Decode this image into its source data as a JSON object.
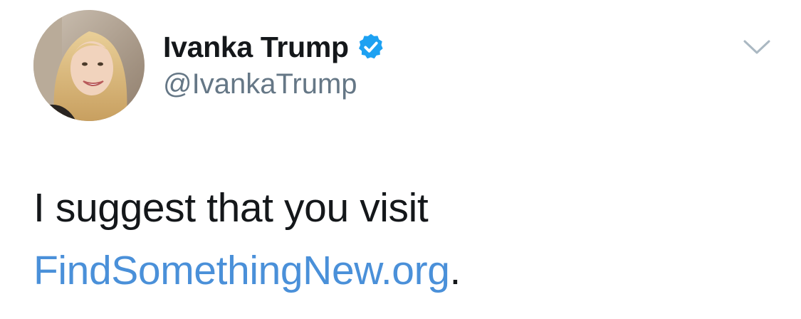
{
  "author": {
    "display_name": "Ivanka Trump",
    "handle": "@IvankaTrump",
    "verified": true,
    "avatar_icon": "profile-photo"
  },
  "menu": {
    "icon": "chevron-down-icon"
  },
  "tweet": {
    "text_line1": "I suggest that you visit",
    "link_text": "FindSomethingNew.org",
    "trailing_text": "."
  },
  "colors": {
    "name": "#14171a",
    "handle": "#657786",
    "link": "#4a90d9",
    "verified_badge": "#1da1f2",
    "chevron": "#aab8c2"
  }
}
